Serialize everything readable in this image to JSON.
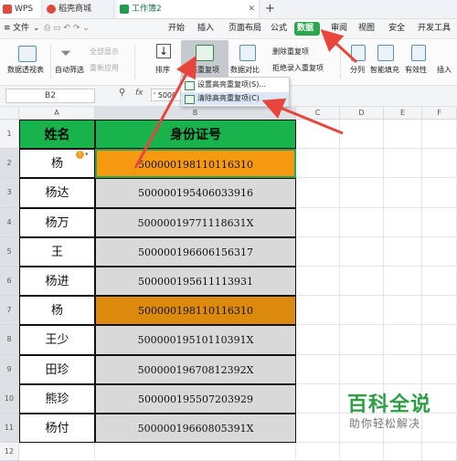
{
  "titlebar": {
    "tabs": [
      {
        "label": "WPS"
      },
      {
        "label": "稻壳商城"
      },
      {
        "label": "工作簿2"
      }
    ],
    "add_tab": "+"
  },
  "menubar": {
    "file": "文件",
    "start": "开始",
    "insert": "插入",
    "page_layout": "页面布局",
    "formula": "公式",
    "data": "数据",
    "review": "审阅",
    "view": "视图",
    "security": "安全",
    "dev_tools": "开发工具"
  },
  "ribbon": {
    "pivot_table": "数据透视表",
    "auto_filter": "自动筛选",
    "show_all": "全部显示",
    "reapply": "重新应用",
    "sort": "排序",
    "highlight_dup": "高亮重复项",
    "data_compare": "数据对比",
    "remove_dup": "删除重复项",
    "reject_dup": "拒绝录入重复项",
    "split": "分列",
    "smart_fill": "智能填充",
    "validity": "有效性",
    "insert_dropdown": "插入"
  },
  "dropdown": {
    "set_highlight": "设置高亮重复项(S)...",
    "clear_highlight": "清除高亮重复项(C)"
  },
  "formula_bar": {
    "name_box": "B2",
    "fx": "fx",
    "value": "' 5000"
  },
  "sheet": {
    "columns": [
      "A",
      "B",
      "C",
      "D",
      "E",
      "F"
    ],
    "rows": [
      "1",
      "2",
      "3",
      "4",
      "5",
      "6",
      "7",
      "8",
      "9",
      "10",
      "11",
      "12"
    ],
    "header": {
      "name": "姓名",
      "id": "身份证号"
    },
    "data": [
      {
        "name": "杨",
        "id": "500000198110116310",
        "style": "dup1"
      },
      {
        "name": "杨达",
        "id": "500000195406033916",
        "style": "plain"
      },
      {
        "name": "杨万",
        "id": "50000019771118631X",
        "style": "plain"
      },
      {
        "name": "王",
        "id": "500000196606156317",
        "style": "plain"
      },
      {
        "name": "杨进",
        "id": "500000195611113931",
        "style": "plain"
      },
      {
        "name": "杨",
        "id": "500000198110116310",
        "style": "dup2"
      },
      {
        "name": "王少",
        "id": "50000019510110391X",
        "style": "plain"
      },
      {
        "name": "田珍",
        "id": "50000019670812392X",
        "style": "plain"
      },
      {
        "name": "熊珍",
        "id": "500000195507203929",
        "style": "plain"
      },
      {
        "name": "杨付",
        "id": "50000019660805391X",
        "style": "plain"
      }
    ]
  },
  "watermark": {
    "title": "百科全说",
    "subtitle": "助你轻松解决"
  },
  "colors": {
    "header_green": "#19b34e",
    "duplicate_orange": "#f59a10",
    "duplicate_orange_dark": "#db8a0e",
    "plain_gray": "#d9d9d9",
    "annotation_red": "#e8453c"
  }
}
